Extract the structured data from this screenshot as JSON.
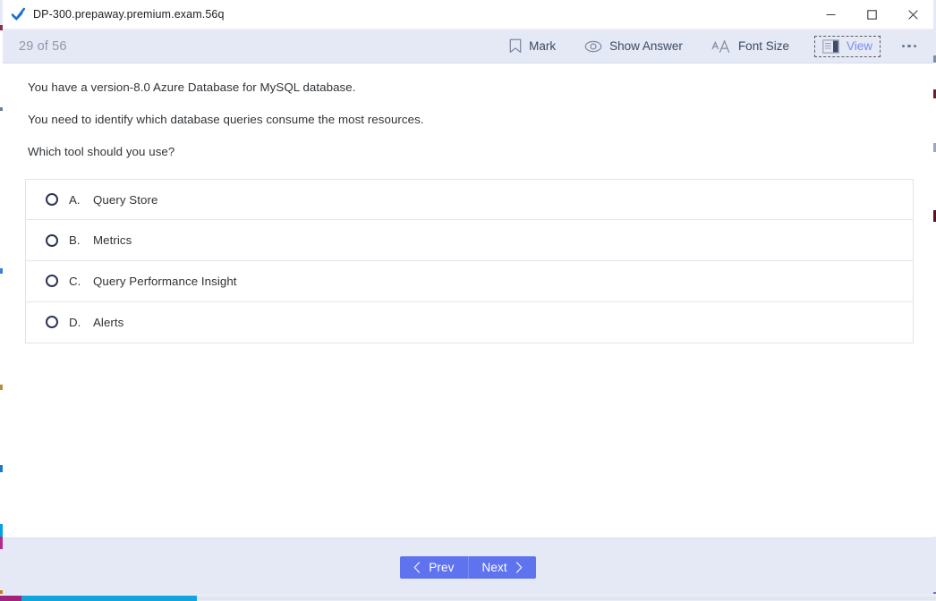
{
  "window": {
    "title": "DP-300.prepaway.premium.exam.56q",
    "app_icon": "blue-checkmark-icon",
    "controls": {
      "minimize": "minimize-button",
      "maximize": "maximize-button",
      "close": "close-button"
    }
  },
  "toolbar": {
    "progress": "29 of 56",
    "current_question": 29,
    "total_questions": 56,
    "actions": [
      {
        "id": "mark",
        "label": "Mark",
        "icon": "bookmark-icon"
      },
      {
        "id": "show-answer",
        "label": "Show Answer",
        "icon": "eye-icon"
      },
      {
        "id": "font-size",
        "label": "Font Size",
        "icon": "font-size-icon"
      },
      {
        "id": "view",
        "label": "View",
        "icon": "layout-panes-icon",
        "focused": true
      }
    ],
    "overflow_label": "more-options",
    "focus_color": "#7a8cf0",
    "background": "#e4e9f5"
  },
  "question": {
    "lines": [
      "You have a version-8.0 Azure Database for MySQL database.",
      "You need to identify which database queries consume the most resources.",
      "Which tool should you use?"
    ],
    "options": [
      {
        "letter": "A.",
        "label": "Query Store",
        "selected": false
      },
      {
        "letter": "B.",
        "label": "Metrics",
        "selected": false
      },
      {
        "letter": "C.",
        "label": "Query Performance Insight",
        "selected": false
      },
      {
        "letter": "D.",
        "label": "Alerts",
        "selected": false
      }
    ]
  },
  "footer": {
    "prev_label": "Prev",
    "next_label": "Next",
    "button_color": "#5f73ef",
    "background": "#e4e9f5"
  }
}
